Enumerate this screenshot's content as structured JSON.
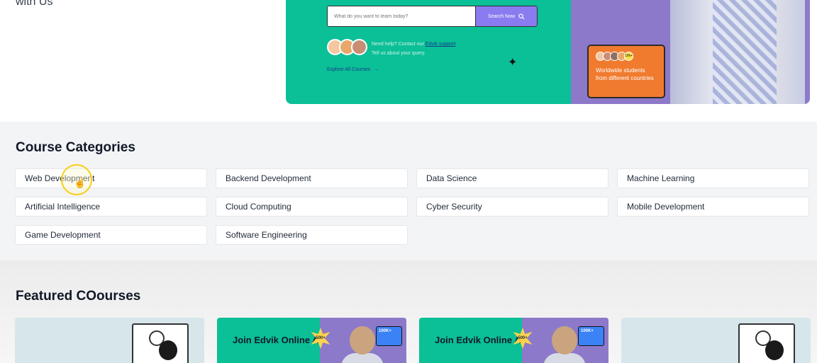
{
  "hero": {
    "left_text": "with Us",
    "search_placeholder": "What do you want to learn today?",
    "search_button": "Search Now",
    "help_line1_prefix": "Need help? Contact our",
    "help_link": "Edvik support",
    "help_line2": "Tell us about your query.",
    "explore_link": "Explore All Courses",
    "stat_count": "10k+",
    "stat_text": "Worldwide students from different countries"
  },
  "categories": {
    "title": "Course Categories",
    "items": [
      "Web Development",
      "Backend Development",
      "Data Science",
      "Machine Learning",
      "Artificial Intelligence",
      "Cloud Computing",
      "Cyber Security",
      "Mobile Development",
      "Game Development",
      "Software Engineering"
    ]
  },
  "featured": {
    "title": "Featured COourses",
    "promo_text": "Join Edvik Online Academy for free",
    "promo_badge": "500+",
    "promo_stat": "100K+"
  },
  "colors": {
    "brand_green": "#0bbf97",
    "accent_purple": "#8b7bf0",
    "stat_orange": "#f07b2f"
  }
}
